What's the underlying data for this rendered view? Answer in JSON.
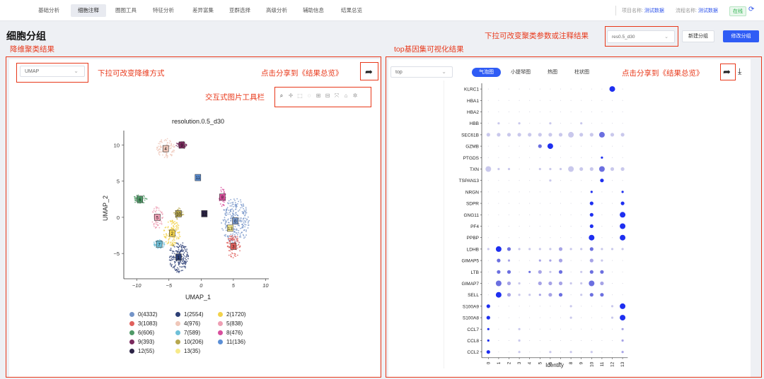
{
  "nav": {
    "items": [
      "基础分析",
      "细胞注释",
      "圈图工具",
      "特征分析",
      "差异富集",
      "亚群选择",
      "高级分析",
      "辅助信息",
      "结果总览"
    ],
    "active_index": 1,
    "project_label": "项目名称:",
    "project_value": "测试数据",
    "flow_label": "流程名称:",
    "flow_value": "测试数据",
    "status": "在线"
  },
  "page": {
    "title": "细胞分组"
  },
  "annotations": {
    "dim_result": "降维聚类结果",
    "top_gene": "top基因集可视化结果",
    "change_cluster": "下拉可改变聚类参数或注释结果",
    "change_dim": "下拉可改变降维方式",
    "share_left": "点击分享到《结果总览》",
    "share_right": "点击分享到《结果总览》",
    "toolbar": "交互式图片工具栏"
  },
  "header": {
    "resolution_select": "res0.5_d30",
    "new_group": "新建分组",
    "edit_group": "修改分组"
  },
  "left": {
    "reduction_select": "UMAP"
  },
  "right": {
    "geneset_select": "top",
    "tabs": [
      "气泡图",
      "小提琴图",
      "热图",
      "柱状图"
    ],
    "active_tab": 0
  },
  "icons": {
    "toolbar": [
      "zoom-icon",
      "pan-icon",
      "box-select-icon",
      "lasso-icon",
      "zoom-in-icon",
      "zoom-out-icon",
      "autoscale-icon",
      "home-icon",
      "settings-icon"
    ],
    "share": "share-icon",
    "download": "download-icon",
    "refresh": "refresh-icon"
  },
  "chart_data": [
    {
      "type": "scatter",
      "title": "resolution.0.5_d30",
      "xlabel": "UMAP_1",
      "ylabel": "UMAP_2",
      "xlim": [
        -12,
        10.5
      ],
      "ylim": [
        -8.5,
        12
      ],
      "xticks": [
        "−10",
        "−5",
        "0",
        "5",
        "10"
      ],
      "yticks": [
        "10",
        "5",
        "0",
        "−5"
      ],
      "clusters": [
        {
          "name": "0(4332)",
          "label": "0",
          "color": "#7494c8",
          "center": [
            5.3,
            -0.5
          ]
        },
        {
          "name": "1(2554)",
          "label": "1",
          "color": "#2c3f75",
          "center": [
            -3.5,
            -5.5
          ]
        },
        {
          "name": "2(1720)",
          "label": "2",
          "color": "#f2d24a",
          "center": [
            -4.5,
            -2.2
          ]
        },
        {
          "name": "3(1083)",
          "label": "3",
          "color": "#e0605c",
          "center": [
            5,
            -4
          ]
        },
        {
          "name": "4(976)",
          "label": "4",
          "color": "#efc7b9",
          "center": [
            -5.5,
            9.5
          ]
        },
        {
          "name": "5(838)",
          "label": "5",
          "color": "#ee9fb4",
          "center": [
            -6.8,
            0
          ]
        },
        {
          "name": "6(606)",
          "label": "6",
          "color": "#4f9a67",
          "center": [
            -9.5,
            2.5
          ]
        },
        {
          "name": "7(589)",
          "label": "7",
          "color": "#6fc0d8",
          "center": [
            -6.5,
            -3.7
          ]
        },
        {
          "name": "8(476)",
          "label": "8",
          "color": "#d84f9d",
          "center": [
            3.3,
            2.8
          ]
        },
        {
          "name": "9(393)",
          "label": "9",
          "color": "#7b2a5e",
          "center": [
            -3,
            10
          ]
        },
        {
          "name": "10(206)",
          "label": "10",
          "color": "#b7a74e",
          "center": [
            -3.5,
            0.5
          ]
        },
        {
          "name": "11(136)",
          "label": "11",
          "color": "#5b8fd6",
          "center": [
            -0.5,
            5.5
          ]
        },
        {
          "name": "12(55)",
          "label": "12",
          "color": "#2c2446",
          "center": [
            0.5,
            0.5
          ]
        },
        {
          "name": "13(35)",
          "label": "13",
          "color": "#f7ea8a",
          "center": [
            4.5,
            -1.5
          ]
        }
      ]
    },
    {
      "type": "scatter",
      "subtype": "dotplot",
      "xlabel": "Identity",
      "categories": [
        "0",
        "1",
        "2",
        "3",
        "4",
        "5",
        "6",
        "7",
        "8",
        "9",
        "10",
        "11",
        "12",
        "13"
      ],
      "genes": [
        "KLRC1",
        "HBA1",
        "HBA2",
        "HBB",
        "SEC61B",
        "GZMB",
        "PTGDS",
        "TXN",
        "TSPAN13",
        "NRGN",
        "SDPR",
        "GNG11",
        "PF4",
        "PPBP",
        "LDHB",
        "GIMAP5",
        "LTB",
        "GIMAP7",
        "SELL",
        "S100A9",
        "S100A8",
        "CCL7",
        "CCL8",
        "CCL2"
      ],
      "dots": [
        [
          [
            12,
            2,
            1
          ]
        ],
        [
          [
            12,
            3,
            1
          ]
        ],
        [
          [
            12,
            3,
            1
          ]
        ],
        [
          [
            12,
            3,
            1
          ],
          [
            1,
            0,
            0.2
          ],
          [
            3,
            0,
            0.2
          ],
          [
            6,
            0,
            0.2
          ],
          [
            9,
            0,
            0.2
          ]
        ],
        [
          [
            0,
            1,
            0.3
          ],
          [
            1,
            1,
            0.2
          ],
          [
            2,
            1,
            0.3
          ],
          [
            3,
            1,
            0.3
          ],
          [
            4,
            1,
            0.3
          ],
          [
            5,
            1,
            0.3
          ],
          [
            6,
            1,
            0.3
          ],
          [
            7,
            1,
            0.3
          ],
          [
            8,
            2,
            0.3
          ],
          [
            9,
            1,
            0.3
          ],
          [
            10,
            1,
            0.3
          ],
          [
            11,
            2,
            0.8
          ],
          [
            12,
            1,
            0.3
          ],
          [
            13,
            1,
            0.3
          ]
        ],
        [
          [
            5,
            1,
            0.7
          ],
          [
            6,
            2,
            1
          ]
        ],
        [
          [
            11,
            0,
            1
          ]
        ],
        [
          [
            0,
            2,
            0.3
          ],
          [
            1,
            0,
            0.2
          ],
          [
            2,
            0,
            0.2
          ],
          [
            5,
            0,
            0.2
          ],
          [
            6,
            0,
            0.2
          ],
          [
            7,
            0,
            0.2
          ],
          [
            8,
            2,
            0.3
          ],
          [
            9,
            1,
            0.3
          ],
          [
            10,
            1,
            0.3
          ],
          [
            11,
            2,
            0.8
          ],
          [
            12,
            1,
            0.3
          ],
          [
            13,
            1,
            0.3
          ]
        ],
        [
          [
            11,
            1,
            0.9
          ],
          [
            6,
            0,
            0.1
          ]
        ],
        [
          [
            10,
            0,
            1
          ],
          [
            13,
            0,
            0.9
          ]
        ],
        [
          [
            10,
            1,
            1
          ],
          [
            13,
            1,
            0.9
          ]
        ],
        [
          [
            10,
            1,
            1
          ],
          [
            13,
            2,
            1
          ]
        ],
        [
          [
            10,
            1,
            1
          ],
          [
            13,
            2,
            1
          ]
        ],
        [
          [
            10,
            2,
            1
          ],
          [
            13,
            2,
            1
          ]
        ],
        [
          [
            0,
            0,
            0.2
          ],
          [
            1,
            2,
            0.9
          ],
          [
            2,
            1,
            0.6
          ],
          [
            3,
            0,
            0.2
          ],
          [
            4,
            0,
            0.3
          ],
          [
            5,
            0,
            0.3
          ],
          [
            6,
            0,
            0.3
          ],
          [
            7,
            1,
            0.5
          ],
          [
            8,
            0,
            0.2
          ],
          [
            9,
            0,
            0.3
          ],
          [
            10,
            1,
            0.6
          ],
          [
            11,
            0,
            0.3
          ],
          [
            12,
            0,
            0.2
          ],
          [
            13,
            0,
            0.2
          ]
        ],
        [
          [
            1,
            1,
            0.8
          ],
          [
            2,
            0,
            0.5
          ],
          [
            5,
            0,
            0.5
          ],
          [
            6,
            0,
            0.5
          ],
          [
            7,
            1,
            0.5
          ],
          [
            10,
            1,
            0.5
          ],
          [
            11,
            0,
            0.3
          ]
        ],
        [
          [
            1,
            1,
            0.8
          ],
          [
            2,
            1,
            0.7
          ],
          [
            4,
            0,
            0.6
          ],
          [
            5,
            1,
            0.5
          ],
          [
            6,
            0,
            0.3
          ],
          [
            7,
            1,
            0.7
          ],
          [
            9,
            0,
            0.3
          ],
          [
            10,
            1,
            0.8
          ],
          [
            11,
            1,
            0.7
          ]
        ],
        [
          [
            1,
            2,
            0.6
          ],
          [
            2,
            1,
            0.5
          ],
          [
            3,
            0,
            0.3
          ],
          [
            5,
            1,
            0.4
          ],
          [
            6,
            1,
            0.4
          ],
          [
            7,
            1,
            0.5
          ],
          [
            8,
            0,
            0.3
          ],
          [
            9,
            0,
            0.3
          ],
          [
            10,
            2,
            0.6
          ],
          [
            11,
            1,
            0.5
          ]
        ],
        [
          [
            1,
            2,
            1
          ],
          [
            2,
            1,
            0.5
          ],
          [
            3,
            0,
            0.3
          ],
          [
            4,
            0,
            0.3
          ],
          [
            5,
            0,
            0.4
          ],
          [
            6,
            1,
            0.4
          ],
          [
            7,
            1,
            0.6
          ],
          [
            9,
            0,
            0.3
          ],
          [
            10,
            1,
            0.6
          ],
          [
            11,
            1,
            0.6
          ]
        ],
        [
          [
            0,
            1,
            1
          ],
          [
            8,
            0,
            0.2
          ],
          [
            12,
            0,
            0.2
          ],
          [
            13,
            2,
            1
          ]
        ],
        [
          [
            0,
            1,
            1
          ],
          [
            8,
            0,
            0.2
          ],
          [
            12,
            0,
            0.2
          ],
          [
            13,
            2,
            1
          ]
        ],
        [
          [
            0,
            0,
            1
          ],
          [
            3,
            0,
            0.1
          ],
          [
            13,
            0,
            0.4
          ]
        ],
        [
          [
            0,
            0,
            1
          ],
          [
            3,
            0,
            0.1
          ],
          [
            13,
            0,
            0.4
          ]
        ],
        [
          [
            0,
            1,
            1
          ],
          [
            3,
            0,
            0.3
          ],
          [
            6,
            0,
            0.3
          ],
          [
            8,
            0,
            0.2
          ],
          [
            10,
            0,
            0.3
          ],
          [
            13,
            0,
            0.5
          ]
        ]
      ]
    }
  ]
}
